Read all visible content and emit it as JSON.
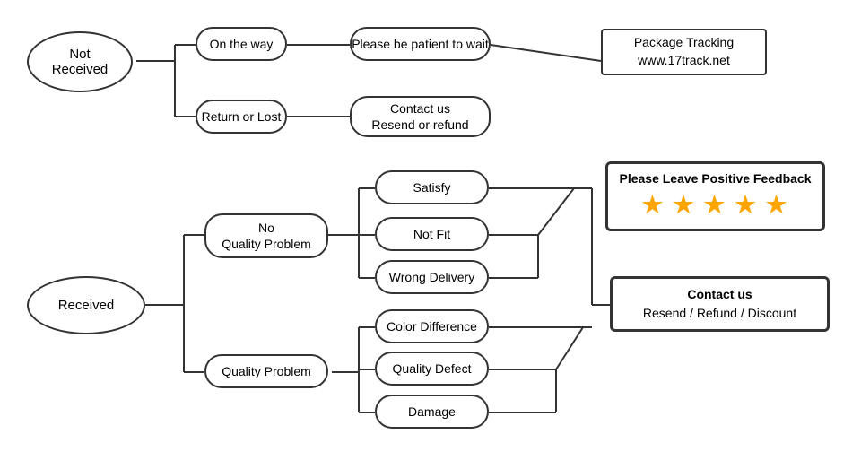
{
  "nodes": {
    "not_received": "Not\nReceived",
    "on_the_way": "On the way",
    "return_or_lost": "Return or Lost",
    "be_patient": "Please be patient to wait",
    "contact_resend": "Contact us\nResend or refund",
    "package_tracking": "Package Tracking\nwww.17track.net",
    "received": "Received",
    "no_quality_problem": "No\nQuality Problem",
    "quality_problem": "Quality Problem",
    "satisfy": "Satisfy",
    "not_fit": "Not Fit",
    "wrong_delivery": "Wrong Delivery",
    "color_difference": "Color Difference",
    "quality_defect": "Quality Defect",
    "damage": "Damage",
    "positive_feedback_label": "Please Leave Positive Feedback",
    "stars": "★ ★ ★ ★ ★",
    "contact_us_label": "Contact us",
    "resend_refund": "Resend / Refund / Discount"
  }
}
